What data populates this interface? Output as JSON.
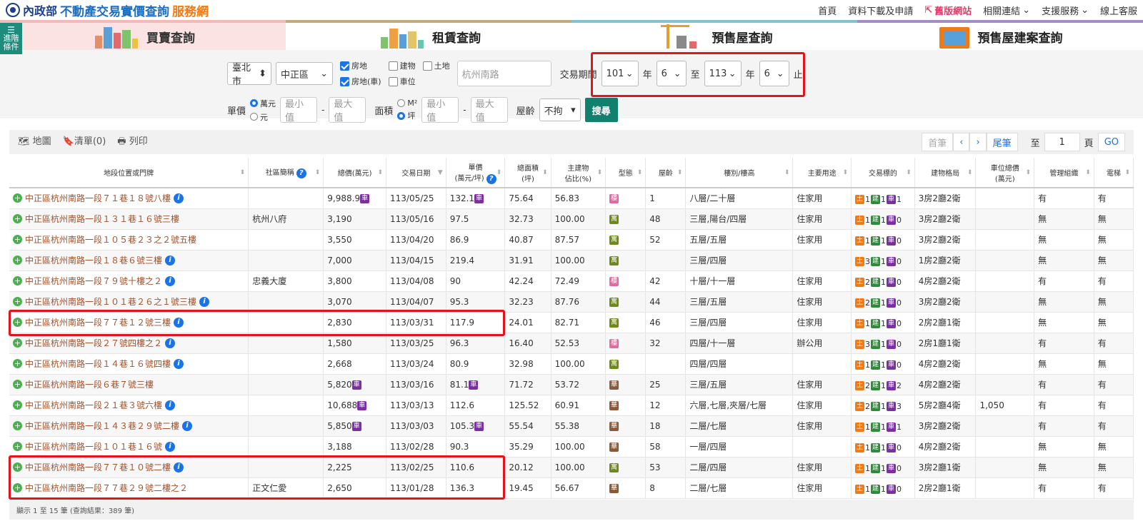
{
  "header": {
    "org": "內政部",
    "site_main": "不動產交易實價查詢",
    "site_suffix": "服務網",
    "nav": [
      "首頁",
      "資料下載及申請",
      "舊版網站",
      "相關連結",
      "支援服務",
      "線上客服"
    ]
  },
  "tabs": {
    "advanced_label": [
      "進階",
      "條件"
    ],
    "items": [
      "買賣查詢",
      "租賃查詢",
      "預售屋查詢",
      "預售屋建案查詢"
    ]
  },
  "filters": {
    "city": "臺北市",
    "district": "中正區",
    "types": [
      {
        "label": "房地",
        "checked": true
      },
      {
        "label": "建物",
        "checked": false
      },
      {
        "label": "土地",
        "checked": false
      },
      {
        "label": "房地(車)",
        "checked": true
      },
      {
        "label": "車位",
        "checked": false
      }
    ],
    "road": "杭州南路",
    "period_label": "交易期間",
    "from_year": "101",
    "from_month": "6",
    "to_label": "至",
    "to_year": "113",
    "to_month": "6",
    "year_unit": "年",
    "suffix": "止",
    "price_label": "單價",
    "price_units": [
      "萬元",
      "元"
    ],
    "min_placeholder": "最小值",
    "max_placeholder": "最大值",
    "area_label": "面積",
    "area_units": [
      "M²",
      "坪"
    ],
    "age_label": "屋齡",
    "age_value": "不拘",
    "search_btn": "搜尋"
  },
  "toolbar": {
    "map": "地圖",
    "list": "清單(0)",
    "print": "列印",
    "first": "首筆",
    "last": "尾筆",
    "to": "至",
    "page": "1",
    "page_unit": "頁",
    "go": "GO"
  },
  "table": {
    "headers": [
      "地段位置或門牌",
      "社區簡稱",
      "總價(萬元)",
      "交易日期",
      "單價\n(萬元/坪)",
      "總面積\n(坪)",
      "主建物\n佔比(%)",
      "型態",
      "屋齡",
      "樓別/樓高",
      "主要用途",
      "交易標的",
      "建物格局",
      "車位總價\n(萬元)",
      "管理組織",
      "電梯"
    ],
    "rows": [
      {
        "addr": "中正區杭州南路一段７１巷１８號八樓",
        "info": true,
        "community": "",
        "price": "9,988.9",
        "price_car": true,
        "date": "113/05/25",
        "unit": "132.1",
        "unit_car": true,
        "area": "75.64",
        "ratio": "56.83",
        "type": "樓",
        "tcls": "t-house",
        "age": "1",
        "floor": "八層/二十層",
        "use": "住家用",
        "tg": [
          "1",
          "1",
          "1"
        ],
        "layout": "3房2廳2衛",
        "carprice": "",
        "mgmt": "有",
        "elev": "有"
      },
      {
        "addr": "中正區杭州南路一段１３１巷１６號三樓",
        "info": false,
        "community": "杭州八府",
        "price": "3,190",
        "price_car": false,
        "date": "113/05/16",
        "unit": "97.5",
        "unit_car": false,
        "area": "32.73",
        "ratio": "100.00",
        "type": "寓",
        "tcls": "t-apt",
        "age": "48",
        "floor": "三層,陽台/四層",
        "use": "住家用",
        "tg": [
          "1",
          "1",
          "0"
        ],
        "layout": "3房2廳2衛",
        "carprice": "",
        "mgmt": "無",
        "elev": "無"
      },
      {
        "addr": "中正區杭州南路一段１０５巷２３之２號五樓",
        "info": false,
        "community": "",
        "price": "3,550",
        "price_car": false,
        "date": "113/04/20",
        "unit": "86.9",
        "unit_car": false,
        "area": "40.87",
        "ratio": "87.57",
        "type": "寓",
        "tcls": "t-apt",
        "age": "52",
        "floor": "五層/五層",
        "use": "住家用",
        "tg": [
          "1",
          "1",
          "0"
        ],
        "layout": "3房2廳2衛",
        "carprice": "",
        "mgmt": "無",
        "elev": "無"
      },
      {
        "addr": "中正區杭州南路一段１８巷６號三樓",
        "info": true,
        "community": "",
        "price": "7,000",
        "price_car": false,
        "date": "113/04/15",
        "unit": "219.4",
        "unit_car": false,
        "area": "31.91",
        "ratio": "100.00",
        "type": "寓",
        "tcls": "t-apt",
        "age": "",
        "floor": "三層/四層",
        "use": "",
        "tg": [
          "3",
          "1",
          "0"
        ],
        "layout": "1房2廳2衛",
        "carprice": "",
        "mgmt": "無",
        "elev": "無"
      },
      {
        "addr": "中正區杭州南路一段７９號十樓之２",
        "info": true,
        "community": "忠義大廈",
        "price": "3,800",
        "price_car": false,
        "date": "113/04/08",
        "unit": "90",
        "unit_car": false,
        "area": "42.24",
        "ratio": "72.49",
        "type": "樓",
        "tcls": "t-house",
        "age": "42",
        "floor": "十層/十一層",
        "use": "住家用",
        "tg": [
          "2",
          "1",
          "0"
        ],
        "layout": "4房2廳2衛",
        "carprice": "",
        "mgmt": "有",
        "elev": "有"
      },
      {
        "addr": "中正區杭州南路一段１０１巷２６之１號三樓",
        "info": true,
        "community": "",
        "price": "3,070",
        "price_car": false,
        "date": "113/04/07",
        "unit": "95.3",
        "unit_car": false,
        "area": "32.23",
        "ratio": "87.76",
        "type": "寓",
        "tcls": "t-apt",
        "age": "44",
        "floor": "三層/五層",
        "use": "住家用",
        "tg": [
          "2",
          "1",
          "0"
        ],
        "layout": "3房2廳2衛",
        "carprice": "",
        "mgmt": "無",
        "elev": "無"
      },
      {
        "addr": "中正區杭州南路一段７７巷１２號三樓",
        "info": true,
        "community": "",
        "price": "2,830",
        "price_car": false,
        "date": "113/03/31",
        "unit": "117.9",
        "unit_car": false,
        "area": "24.01",
        "ratio": "82.71",
        "type": "寓",
        "tcls": "t-apt",
        "age": "46",
        "floor": "三層/四層",
        "use": "住家用",
        "tg": [
          "1",
          "1",
          "0"
        ],
        "layout": "2房2廳1衛",
        "carprice": "",
        "mgmt": "無",
        "elev": "無"
      },
      {
        "addr": "中正區杭州南路一段２７號四樓之２",
        "info": true,
        "community": "",
        "price": "1,580",
        "price_car": false,
        "date": "113/03/25",
        "unit": "96.3",
        "unit_car": false,
        "area": "16.40",
        "ratio": "52.53",
        "type": "樓",
        "tcls": "t-house",
        "age": "32",
        "floor": "四層/十一層",
        "use": "辦公用",
        "tg": [
          "3",
          "1",
          "0"
        ],
        "layout": "2房1廳1衛",
        "carprice": "",
        "mgmt": "有",
        "elev": "有"
      },
      {
        "addr": "中正區杭州南路一段１４巷１６號四樓",
        "info": true,
        "community": "",
        "price": "2,668",
        "price_car": false,
        "date": "113/03/24",
        "unit": "80.9",
        "unit_car": false,
        "area": "32.98",
        "ratio": "100.00",
        "type": "寓",
        "tcls": "t-apt",
        "age": "",
        "floor": "四層/四層",
        "use": "",
        "tg": [
          "1",
          "1",
          "0"
        ],
        "layout": "4房2廳2衛",
        "carprice": "",
        "mgmt": "無",
        "elev": "無"
      },
      {
        "addr": "中正區杭州南路一段６巷７號三樓",
        "info": false,
        "community": "",
        "price": "5,820",
        "price_car": true,
        "date": "113/03/16",
        "unit": "81.1",
        "unit_car": true,
        "area": "71.72",
        "ratio": "53.72",
        "type": "華",
        "tcls": "t-flat",
        "age": "25",
        "floor": "三層/五層",
        "use": "住家用",
        "tg": [
          "2",
          "1",
          "2"
        ],
        "layout": "4房2廳2衛",
        "carprice": "",
        "mgmt": "有",
        "elev": "有"
      },
      {
        "addr": "中正區杭州南路一段２１巷３號六樓",
        "info": true,
        "community": "",
        "price": "10,688",
        "price_car": true,
        "date": "113/03/13",
        "unit": "112.6",
        "unit_car": false,
        "area": "125.52",
        "ratio": "60.91",
        "type": "華",
        "tcls": "t-flat",
        "age": "12",
        "floor": "六層,七層,夾層/七層",
        "use": "住家用",
        "tg": [
          "2",
          "1",
          "3"
        ],
        "layout": "5房2廳4衛",
        "carprice": "1,050",
        "mgmt": "有",
        "elev": "有"
      },
      {
        "addr": "中正區杭州南路一段１４３巷２９號二樓",
        "info": true,
        "community": "",
        "price": "5,850",
        "price_car": true,
        "date": "113/03/03",
        "unit": "105.3",
        "unit_car": true,
        "area": "55.54",
        "ratio": "55.38",
        "type": "華",
        "tcls": "t-flat",
        "age": "18",
        "floor": "二層/七層",
        "use": "住家用",
        "tg": [
          "1",
          "1",
          "1"
        ],
        "layout": "3房2廳2衛",
        "carprice": "",
        "mgmt": "有",
        "elev": "有"
      },
      {
        "addr": "中正區杭州南路一段１０１巷１６號",
        "info": true,
        "community": "",
        "price": "3,188",
        "price_car": false,
        "date": "113/02/28",
        "unit": "90.3",
        "unit_car": false,
        "area": "35.29",
        "ratio": "100.00",
        "type": "華",
        "tcls": "t-flat",
        "age": "58",
        "floor": "一層/四層",
        "use": "",
        "tg": [
          "1",
          "1",
          "0"
        ],
        "layout": "4房2廳2衛",
        "carprice": "",
        "mgmt": "無",
        "elev": "無"
      },
      {
        "addr": "中正區杭州南路一段７７巷１０號二樓",
        "info": true,
        "community": "",
        "price": "2,225",
        "price_car": false,
        "date": "113/02/25",
        "unit": "110.6",
        "unit_car": false,
        "area": "20.12",
        "ratio": "100.00",
        "type": "寓",
        "tcls": "t-apt",
        "age": "53",
        "floor": "二層/四層",
        "use": "住家用",
        "tg": [
          "1",
          "1",
          "0"
        ],
        "layout": "3房2廳1衛",
        "carprice": "",
        "mgmt": "無",
        "elev": "無"
      },
      {
        "addr": "中正區杭州南路一段７７巷２９號二樓之２",
        "info": false,
        "community": "正文仁愛",
        "price": "2,650",
        "price_car": false,
        "date": "113/01/28",
        "unit": "136.3",
        "unit_car": false,
        "area": "19.45",
        "ratio": "56.67",
        "type": "華",
        "tcls": "t-flat",
        "age": "8",
        "floor": "二層/七層",
        "use": "住家用",
        "tg": [
          "1",
          "1",
          "0"
        ],
        "layout": "2房2廳1衛",
        "carprice": "",
        "mgmt": "有",
        "elev": "有"
      }
    ]
  },
  "footer": {
    "summary": "顯示 1 至 15 筆 (查詢結果：389 筆)"
  }
}
